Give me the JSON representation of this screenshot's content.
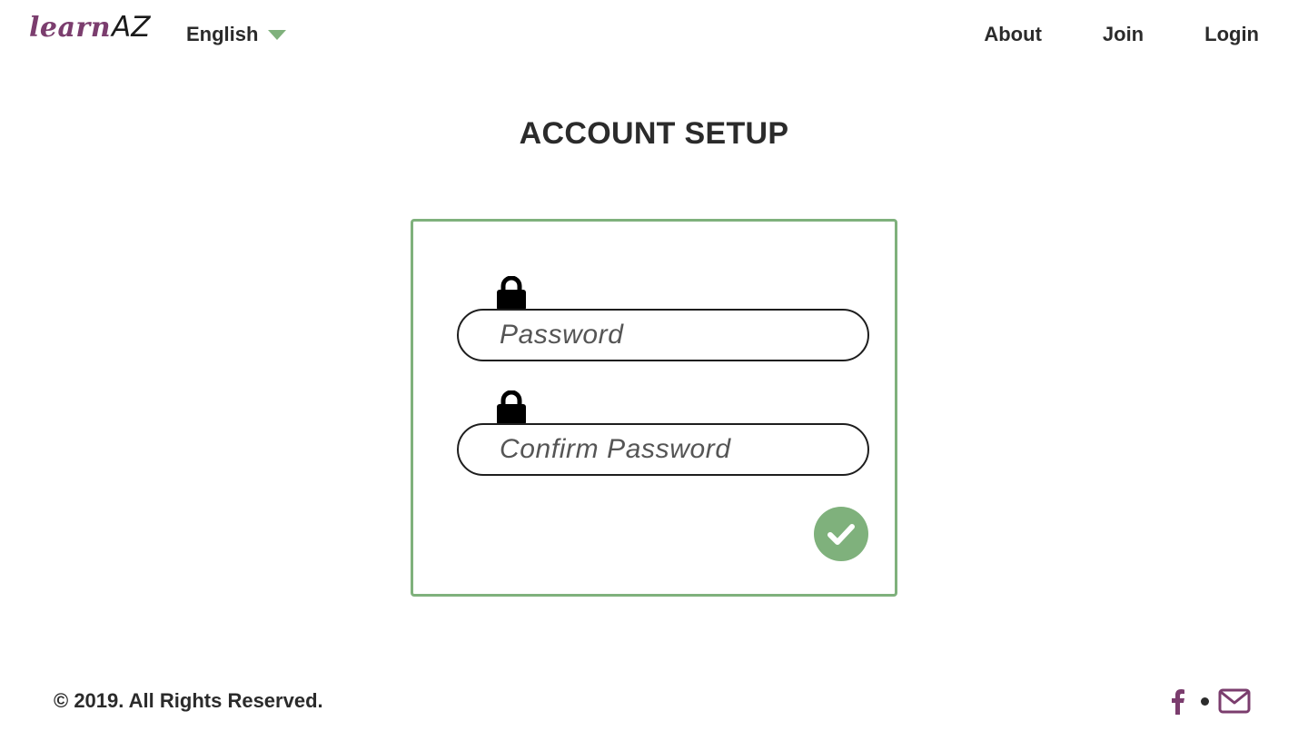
{
  "header": {
    "logo_learn": "learn",
    "logo_az": "AZ",
    "language": "English",
    "nav": {
      "about": "About",
      "join": "Join",
      "login": "Login"
    }
  },
  "main": {
    "title": "ACCOUNT SETUP",
    "form": {
      "password_placeholder": "Password",
      "password_value": "",
      "confirm_placeholder": "Confirm Password",
      "confirm_value": "",
      "submit_icon": "check-icon"
    }
  },
  "footer": {
    "copyright": "© 2019. All Rights Reserved.",
    "social_icons": [
      "facebook-icon",
      "email-icon"
    ]
  },
  "colors": {
    "accent_green": "#7fb17c",
    "brand_purple": "#7b3d6e",
    "text_dark": "#2b2b2b"
  }
}
